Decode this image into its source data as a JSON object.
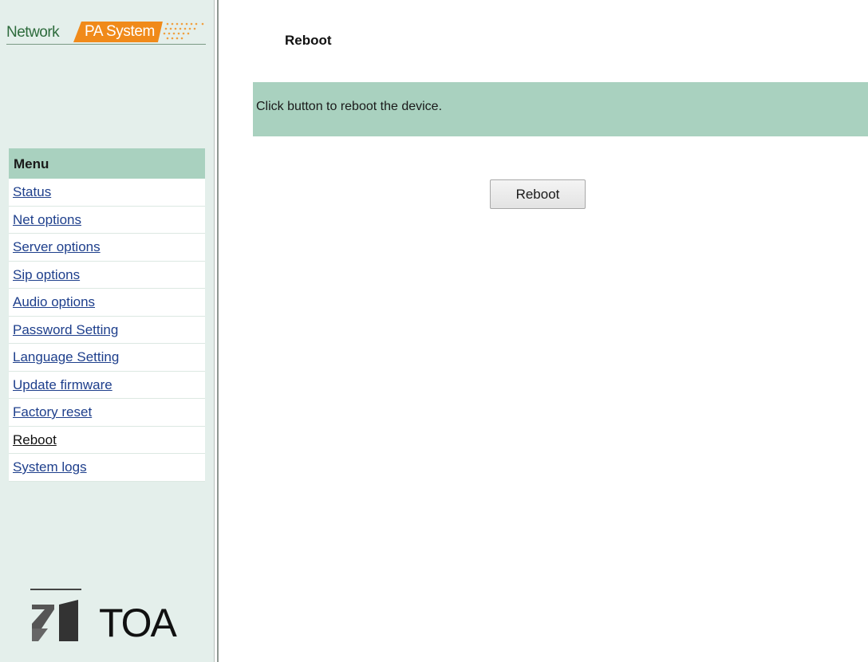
{
  "brand": {
    "network": "Network",
    "pa_system": "PA System",
    "logo_text": "TOA"
  },
  "menu": {
    "header": "Menu",
    "items": [
      {
        "label": "Status"
      },
      {
        "label": "Net options"
      },
      {
        "label": "Server options"
      },
      {
        "label": "Sip options"
      },
      {
        "label": "Audio options"
      },
      {
        "label": "Password Setting"
      },
      {
        "label": "Language Setting"
      },
      {
        "label": "Update firmware"
      },
      {
        "label": "Factory reset"
      },
      {
        "label": "Reboot"
      },
      {
        "label": "System logs"
      }
    ],
    "active_label": "Reboot"
  },
  "main": {
    "title": "Reboot",
    "info": "Click button to reboot the device.",
    "button_label": "Reboot"
  },
  "colors": {
    "accent_green": "#a9d1bf",
    "sidebar_bg": "#e4efeb",
    "brand_orange": "#f08a1a",
    "link_blue": "#1e3f8c"
  }
}
